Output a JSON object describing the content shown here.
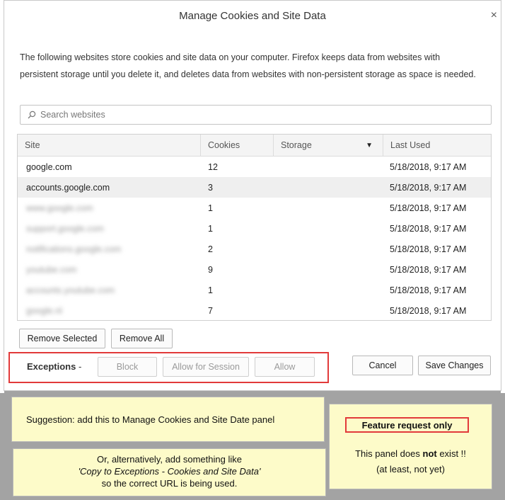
{
  "dialog": {
    "title": "Manage Cookies and Site Data",
    "close_glyph": "×",
    "description": "The following websites store cookies and site data on your computer. Firefox keeps data from websites with persistent storage until you delete it, and deletes data from websites with non-persistent storage as space is needed."
  },
  "search": {
    "placeholder": "Search websites"
  },
  "table": {
    "headers": {
      "site": "Site",
      "cookies": "Cookies",
      "storage": "Storage",
      "last_used": "Last Used"
    },
    "rows": [
      {
        "site": "google.com",
        "cookies": "12",
        "storage": "",
        "last_used": "5/18/2018, 9:17 AM"
      },
      {
        "site": "accounts.google.com",
        "cookies": "3",
        "storage": "",
        "last_used": "5/18/2018, 9:17 AM"
      },
      {
        "site": "www.google.com",
        "cookies": "1",
        "storage": "",
        "last_used": "5/18/2018, 9:17 AM"
      },
      {
        "site": "support.google.com",
        "cookies": "1",
        "storage": "",
        "last_used": "5/18/2018, 9:17 AM"
      },
      {
        "site": "notifications.google.com",
        "cookies": "2",
        "storage": "",
        "last_used": "5/18/2018, 9:17 AM"
      },
      {
        "site": "youtube.com",
        "cookies": "9",
        "storage": "",
        "last_used": "5/18/2018, 9:17 AM"
      },
      {
        "site": "accounts.youtube.com",
        "cookies": "1",
        "storage": "",
        "last_used": "5/18/2018, 9:17 AM"
      },
      {
        "site": "google.nl",
        "cookies": "7",
        "storage": "",
        "last_used": "5/18/2018, 9:17 AM"
      }
    ]
  },
  "buttons": {
    "remove_selected": "Remove Selected",
    "remove_all": "Remove All",
    "block": "Block",
    "allow_session": "Allow for Session",
    "allow": "Allow",
    "cancel": "Cancel",
    "save_changes": "Save Changes"
  },
  "exceptions": {
    "label": "Exceptions",
    "dash": " -"
  },
  "notes": {
    "suggestion": "Suggestion: add this to Manage Cookies and Site Date panel",
    "alt_line1": "Or, alternatively, add something like",
    "alt_line2": "'Copy to Exceptions - Cookies and Site Data'",
    "alt_line3": "so the correct URL is being used.",
    "feature_request": "Feature request only",
    "panel_pre": "This panel does ",
    "panel_bold": "not",
    "panel_post": " exist !!",
    "panel_line2": "(at least, not yet)"
  },
  "colors": {
    "highlight_border": "#e23a3a",
    "note_bg": "#fdfbc9"
  }
}
